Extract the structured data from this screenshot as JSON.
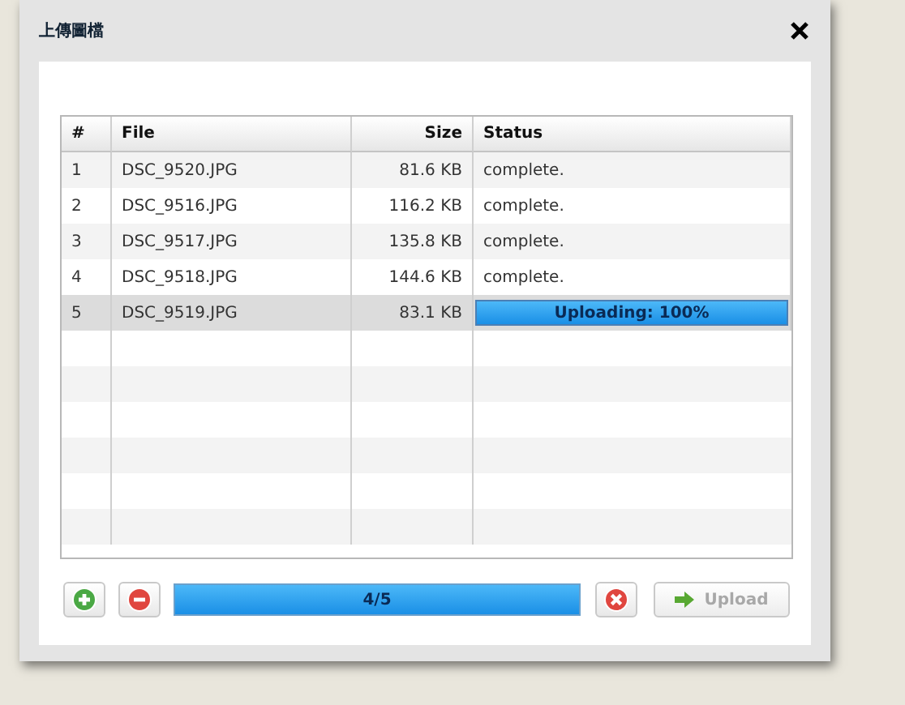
{
  "window": {
    "title": "上傳圖檔"
  },
  "table": {
    "columns": [
      "#",
      "File",
      "Size",
      "Status"
    ],
    "rows": [
      {
        "index": "1",
        "file": "DSC_9520.JPG",
        "size": "81.6 KB",
        "status": {
          "kind": "text",
          "text": "complete."
        },
        "selected": false
      },
      {
        "index": "2",
        "file": "DSC_9516.JPG",
        "size": "116.2 KB",
        "status": {
          "kind": "text",
          "text": "complete."
        },
        "selected": false
      },
      {
        "index": "3",
        "file": "DSC_9517.JPG",
        "size": "135.8 KB",
        "status": {
          "kind": "text",
          "text": "complete."
        },
        "selected": false
      },
      {
        "index": "4",
        "file": "DSC_9518.JPG",
        "size": "144.6 KB",
        "status": {
          "kind": "text",
          "text": "complete."
        },
        "selected": false
      },
      {
        "index": "5",
        "file": "DSC_9519.JPG",
        "size": "83.1 KB",
        "status": {
          "kind": "progress",
          "text": "Uploading: 100%",
          "level": 1
        },
        "selected": true
      }
    ]
  },
  "toolbar": {
    "progress": {
      "text": "4/5",
      "level": 1
    },
    "upload": {
      "label": "Upload",
      "disabled": true
    }
  }
}
